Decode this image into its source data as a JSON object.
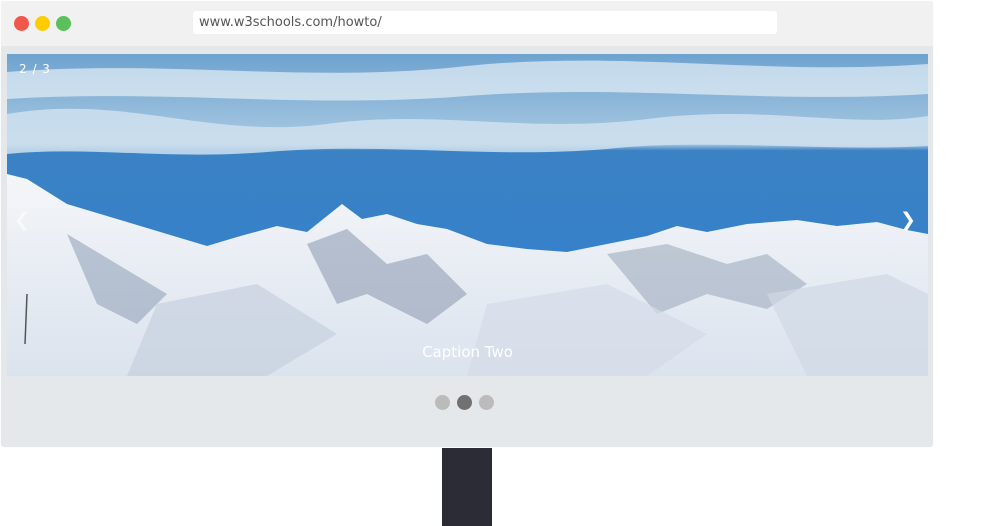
{
  "browser": {
    "url": "www.w3schools.com/howto/",
    "controls": [
      "close",
      "minimize",
      "maximize"
    ]
  },
  "slideshow": {
    "counter": "2 / 3",
    "caption": "Caption Two",
    "prev_icon": "❮",
    "next_icon": "❯",
    "dots": [
      {
        "label": "slide 1",
        "active": false
      },
      {
        "label": "slide 2",
        "active": true
      },
      {
        "label": "slide 3",
        "active": false
      }
    ]
  },
  "colors": {
    "dot_inactive": "#bbbbbb",
    "dot_active": "#717171",
    "stand": "#2b2c35"
  }
}
